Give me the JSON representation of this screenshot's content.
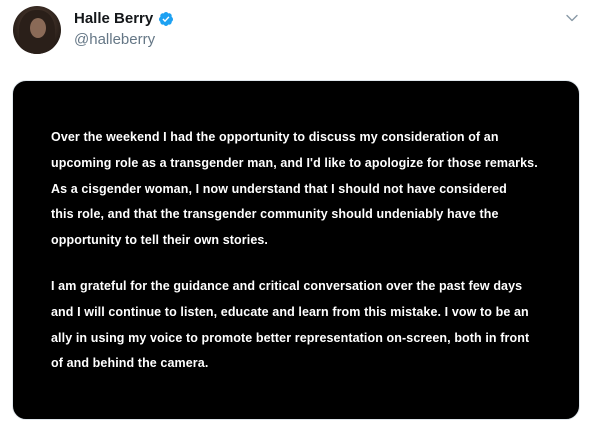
{
  "author": {
    "display_name": "Halle Berry",
    "handle": "@halleberry",
    "verified": true,
    "verified_color": "#1da1f2"
  },
  "menu_icon": "chevron-down-icon",
  "statement": {
    "paragraph1": [
      "Over the weekend I had the opportunity to discuss my consideration of an",
      "upcoming role as a transgender man, and I'd like to apologize for those remarks.",
      "As a cisgender woman, I now understand that I should not have considered",
      "this role, and that the transgender community should undeniably have the",
      "opportunity to tell their own stories."
    ],
    "paragraph2": [
      "I am grateful for the guidance and critical conversation over the past few days",
      "and I will continue to listen, educate and learn from this mistake. I vow to be an",
      "ally in using my voice to promote better representation on-screen, both in front",
      "of and behind the camera."
    ]
  }
}
